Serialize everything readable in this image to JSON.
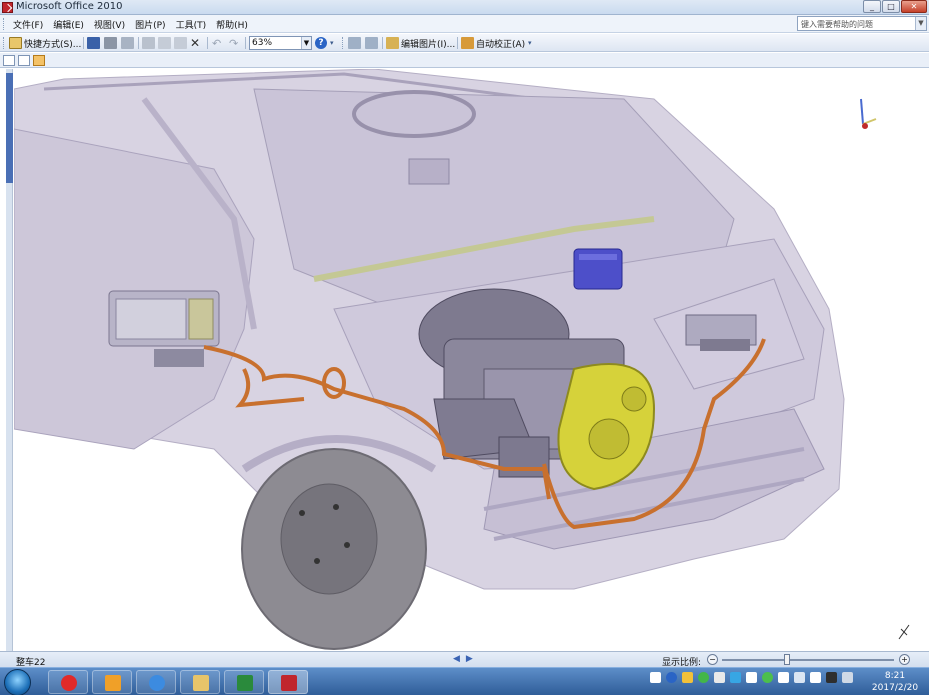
{
  "window": {
    "title": "Microsoft Office 2010",
    "controls": {
      "minimize": "_",
      "restore": "□",
      "close": "✕"
    }
  },
  "menu": {
    "items": [
      "文件(F)",
      "编辑(E)",
      "视图(V)",
      "图片(P)",
      "工具(T)",
      "帮助(H)"
    ],
    "help_placeholder": "键入需要帮助的问题"
  },
  "toolbar": {
    "shortcut_label": "快捷方式(S)...",
    "zoom_value": "63%",
    "edit_picture_label": "编辑图片(I)...",
    "auto_correct_label": "自动校正(A)"
  },
  "status": {
    "image_name": "整车22",
    "scale_label": "显示比例:",
    "zoom_minus": "−",
    "zoom_plus": "+",
    "zoom_slider_level": 0.38
  },
  "taskbar": {
    "time": "8:21",
    "date": "2017/2/20"
  },
  "colors": {
    "accent": "#2a64c5",
    "car_body": "#c9c3d6",
    "harness": "#c8702e",
    "engine_yellow": "#d6d23a",
    "ecu_blue": "#4d4fc9"
  }
}
